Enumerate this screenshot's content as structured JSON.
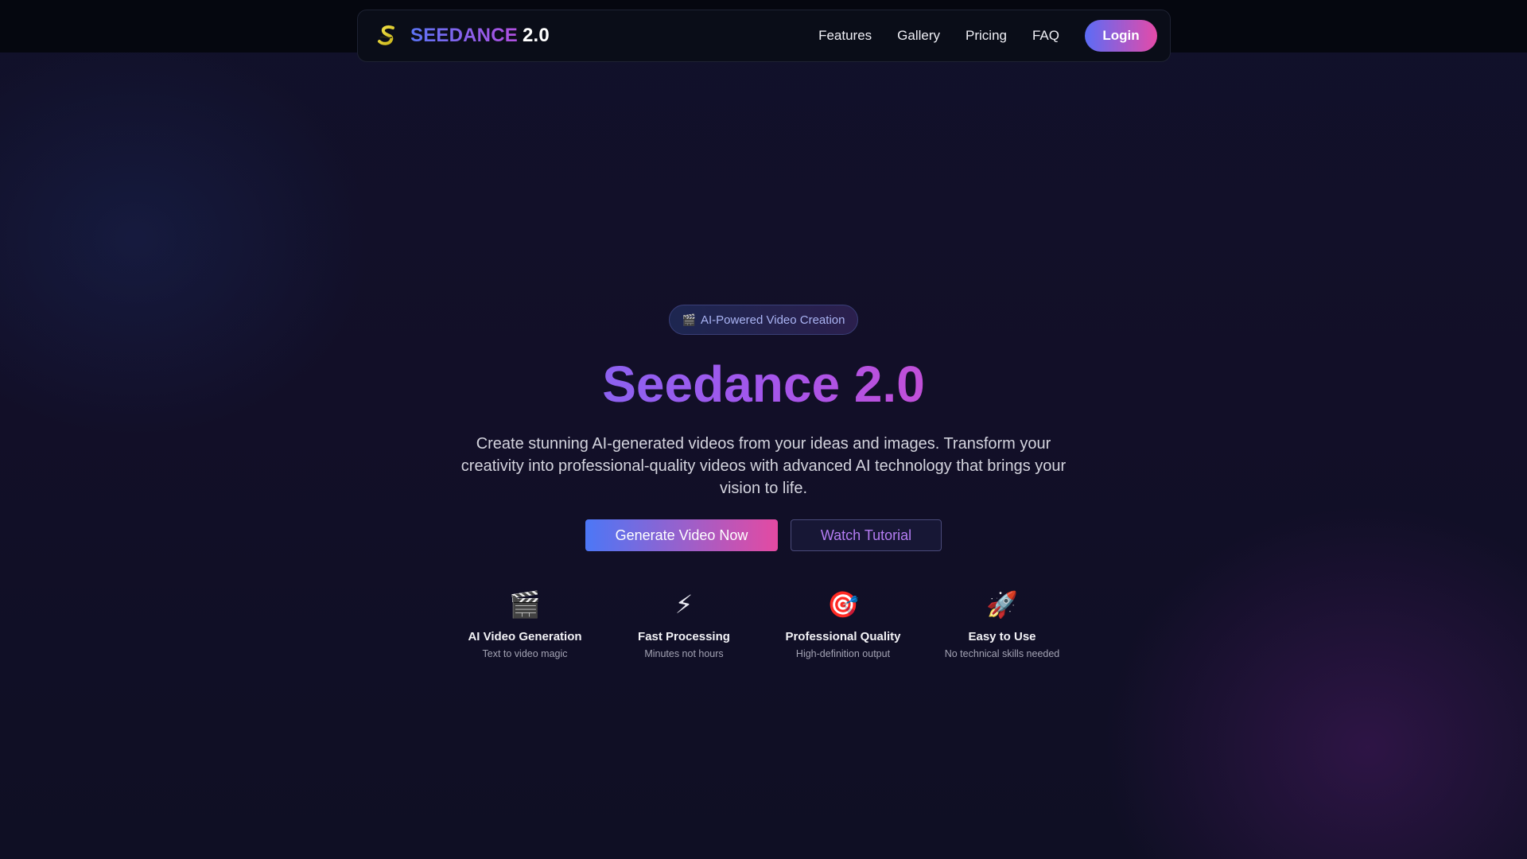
{
  "nav": {
    "brand_name": "SEEDANCE",
    "brand_version": "2.0",
    "links": [
      "Features",
      "Gallery",
      "Pricing",
      "FAQ"
    ],
    "login_label": "Login"
  },
  "hero": {
    "badge_icon": "🎬",
    "badge_text": "AI-Powered Video Creation",
    "title": "Seedance 2.0",
    "description": "Create stunning AI-generated videos from your ideas and images. Transform your creativity into professional-quality videos with advanced AI technology that brings your vision to life.",
    "primary_cta": "Generate Video Now",
    "secondary_cta": "Watch Tutorial"
  },
  "features": [
    {
      "icon": "🎬",
      "title": "AI Video Generation",
      "subtitle": "Text to video magic"
    },
    {
      "icon": "⚡",
      "title": "Fast Processing",
      "subtitle": "Minutes not hours"
    },
    {
      "icon": "🎯",
      "title": "Professional Quality",
      "subtitle": "High-definition output"
    },
    {
      "icon": "🚀",
      "title": "Easy to Use",
      "subtitle": "No technical skills needed"
    }
  ],
  "colors": {
    "background": "#0f0f24",
    "accent_blue": "#5b6cf6",
    "accent_pink": "#e54aa8",
    "accent_purple": "#a356ec"
  }
}
